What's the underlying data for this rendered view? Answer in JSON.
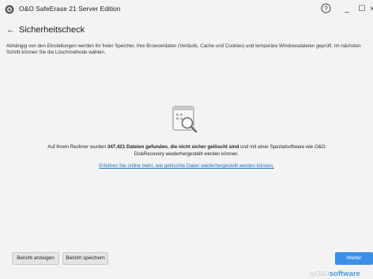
{
  "window": {
    "title": "O&O SafeErase 21 Server Edition",
    "help_glyph": "?",
    "minimize_glyph": "_",
    "maximize_glyph": "☐",
    "close_glyph": "×"
  },
  "header": {
    "back_glyph": "←",
    "title": "Sicherheitscheck"
  },
  "description": "Abhängig von den Einstellungen werden Ihr freier Speicher, Ihre Browserdaten (Verläufe, Cache und Cookies) und temporäre Windowsdateien geprüft. Im nächsten Schritt können Sie die Löschmethode wählen.",
  "result": {
    "icon": "search-files-icon",
    "text_before": "Auf Ihrem Rechner wurden ",
    "text_bold": "347,421 Dateien gefunden, die nicht sicher gelöscht sind",
    "text_after": " und mit einer Spezialsoftware wie O&O DiskRecovery wiederhergestellt werden können.",
    "link": "Erfahren Sie online mehr, wie gelöschte Daten wiederhergestellt werden können."
  },
  "footer": {
    "show_report": "Bericht anzeigen",
    "save_report": "Bericht speichern",
    "next": "Weiter"
  },
  "brand": {
    "mark": "◎O&O",
    "name": "software"
  },
  "colors": {
    "accent": "#3b8fe8",
    "link": "#1a6fc2",
    "background": "#f3f3f3"
  }
}
